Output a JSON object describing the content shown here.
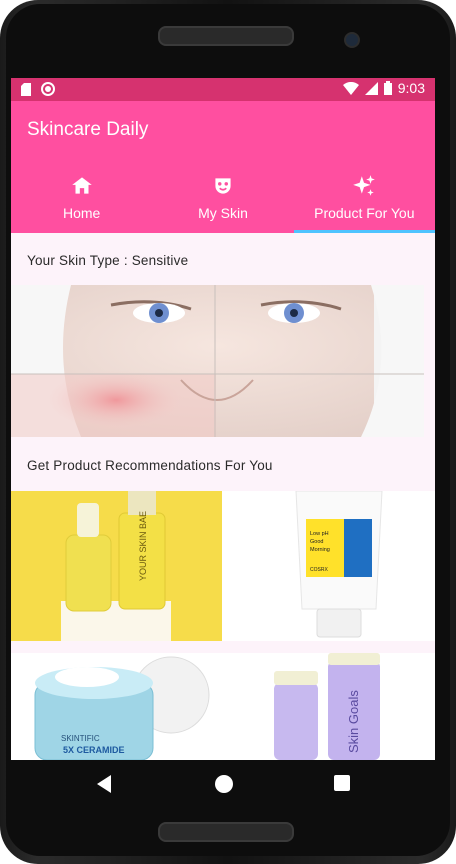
{
  "status_bar": {
    "time": "9:03",
    "left_icons": [
      "sd-card-icon",
      "record-icon"
    ],
    "right_icons": [
      "wifi-icon",
      "signal-icon",
      "battery-icon"
    ]
  },
  "app": {
    "title": "Skincare Daily",
    "brand_color": "#ff4fa0",
    "status_color": "#d6326f",
    "indicator_color": "#4fc3ff"
  },
  "tabs": [
    {
      "label": "Home",
      "icon": "home-icon",
      "active": false
    },
    {
      "label": "My Skin",
      "icon": "face-mask-icon",
      "active": false
    },
    {
      "label": "Product For You",
      "icon": "sparkles-icon",
      "active": true
    }
  ],
  "content": {
    "skin_type_text": "Your Skin Type : Sensitive",
    "recommendations_title": "Get Product Recommendations For You",
    "products": [
      {
        "name": "your-skin-bae-serums",
        "brand_text": "YOUR SKIN BAE"
      },
      {
        "name": "low-ph-gel-cleanser",
        "brand_text": "COSRX",
        "label_text": "Low pH Good Morning Gel Cleanser"
      },
      {
        "name": "5x-ceramide-cream",
        "brand_text": "SKINTIFIC",
        "label_text": "5X CERAMIDE"
      },
      {
        "name": "skin-goals-tubes",
        "brand_text": "Skin Goals"
      }
    ]
  },
  "nav_bar": {
    "buttons": [
      "back-icon",
      "home-circle-icon",
      "recents-icon"
    ]
  }
}
